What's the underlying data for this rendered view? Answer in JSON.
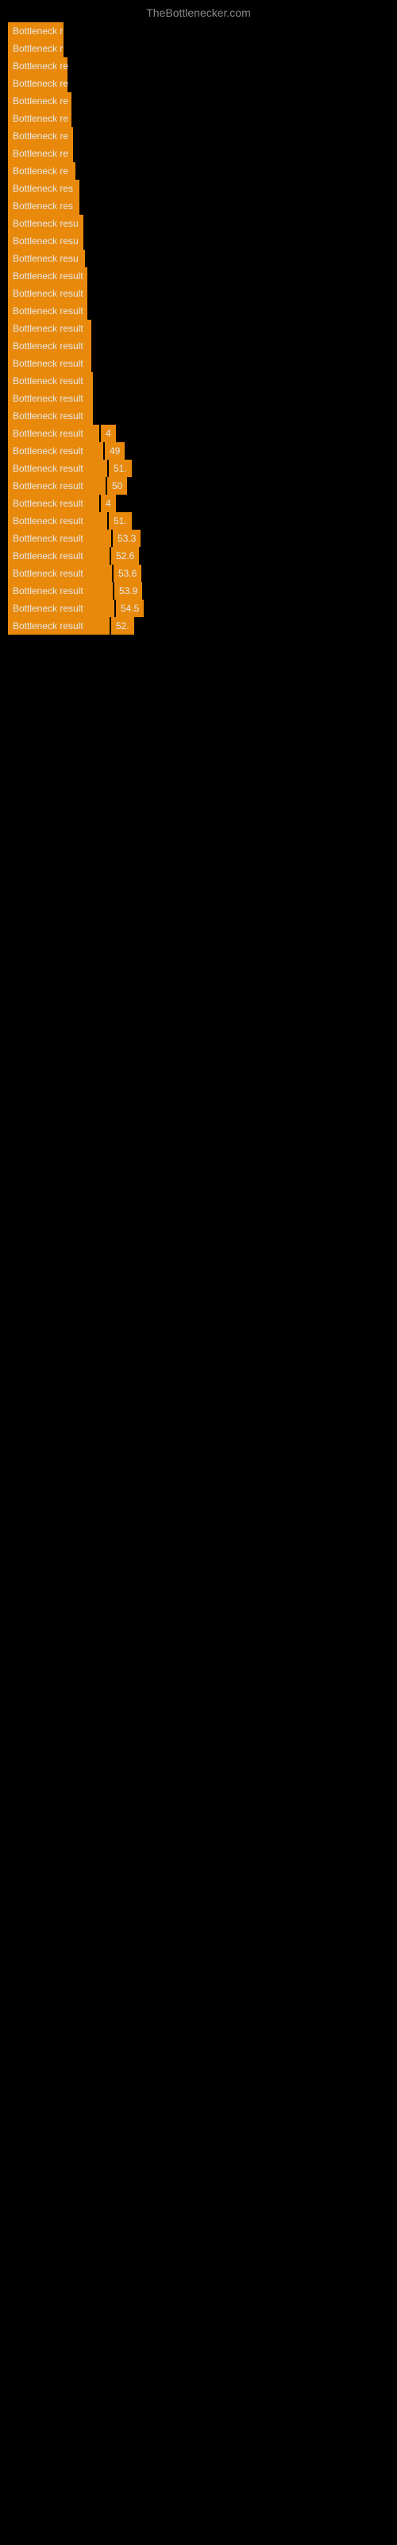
{
  "site": {
    "title": "TheBottlenecker.com"
  },
  "rows": [
    {
      "label": "Bottleneck r",
      "value": "",
      "barWidth": 70,
      "hasValue": false
    },
    {
      "label": "Bottleneck r",
      "value": "",
      "barWidth": 70,
      "hasValue": false
    },
    {
      "label": "Bottleneck re",
      "value": "",
      "barWidth": 75,
      "hasValue": false
    },
    {
      "label": "Bottleneck re",
      "value": "",
      "barWidth": 75,
      "hasValue": false
    },
    {
      "label": "Bottleneck re",
      "value": "",
      "barWidth": 80,
      "hasValue": false
    },
    {
      "label": "Bottleneck re",
      "value": "",
      "barWidth": 80,
      "hasValue": false
    },
    {
      "label": "Bottleneck re",
      "value": "",
      "barWidth": 82,
      "hasValue": false
    },
    {
      "label": "Bottleneck re",
      "value": "",
      "barWidth": 82,
      "hasValue": false
    },
    {
      "label": "Bottleneck re",
      "value": "",
      "barWidth": 85,
      "hasValue": false
    },
    {
      "label": "Bottleneck res",
      "value": "",
      "barWidth": 90,
      "hasValue": false
    },
    {
      "label": "Bottleneck res",
      "value": "",
      "barWidth": 90,
      "hasValue": false
    },
    {
      "label": "Bottleneck resu",
      "value": "",
      "barWidth": 95,
      "hasValue": false
    },
    {
      "label": "Bottleneck resu",
      "value": "",
      "barWidth": 95,
      "hasValue": false
    },
    {
      "label": "Bottleneck resu",
      "value": "",
      "barWidth": 97,
      "hasValue": false
    },
    {
      "label": "Bottleneck result",
      "value": "",
      "barWidth": 100,
      "hasValue": false
    },
    {
      "label": "Bottleneck result",
      "value": "",
      "barWidth": 100,
      "hasValue": false
    },
    {
      "label": "Bottleneck result",
      "value": "",
      "barWidth": 100,
      "hasValue": false
    },
    {
      "label": "Bottleneck result",
      "value": "",
      "barWidth": 105,
      "hasValue": false
    },
    {
      "label": "Bottleneck result",
      "value": "",
      "barWidth": 105,
      "hasValue": false
    },
    {
      "label": "Bottleneck result",
      "value": "",
      "barWidth": 105,
      "hasValue": false
    },
    {
      "label": "Bottleneck result",
      "value": "",
      "barWidth": 107,
      "hasValue": false
    },
    {
      "label": "Bottleneck result",
      "value": "",
      "barWidth": 107,
      "hasValue": false
    },
    {
      "label": "Bottleneck result",
      "value": "",
      "barWidth": 107,
      "hasValue": false
    },
    {
      "label": "Bottleneck result",
      "value": "4",
      "barWidth": 115,
      "hasValue": true
    },
    {
      "label": "Bottleneck result",
      "value": "49",
      "barWidth": 120,
      "hasValue": true
    },
    {
      "label": "Bottleneck result",
      "value": "51.",
      "barWidth": 125,
      "hasValue": true
    },
    {
      "label": "Bottleneck result",
      "value": "50",
      "barWidth": 123,
      "hasValue": true
    },
    {
      "label": "Bottleneck result",
      "value": "4",
      "barWidth": 115,
      "hasValue": true
    },
    {
      "label": "Bottleneck result",
      "value": "51.",
      "barWidth": 125,
      "hasValue": true
    },
    {
      "label": "Bottleneck result",
      "value": "53.3",
      "barWidth": 130,
      "hasValue": true
    },
    {
      "label": "Bottleneck result",
      "value": "52.6",
      "barWidth": 128,
      "hasValue": true
    },
    {
      "label": "Bottleneck result",
      "value": "53.6",
      "barWidth": 131,
      "hasValue": true
    },
    {
      "label": "Bottleneck result",
      "value": "53.9",
      "barWidth": 132,
      "hasValue": true
    },
    {
      "label": "Bottleneck result",
      "value": "54.5",
      "barWidth": 134,
      "hasValue": true
    },
    {
      "label": "Bottleneck result",
      "value": "52.",
      "barWidth": 128,
      "hasValue": true
    }
  ]
}
